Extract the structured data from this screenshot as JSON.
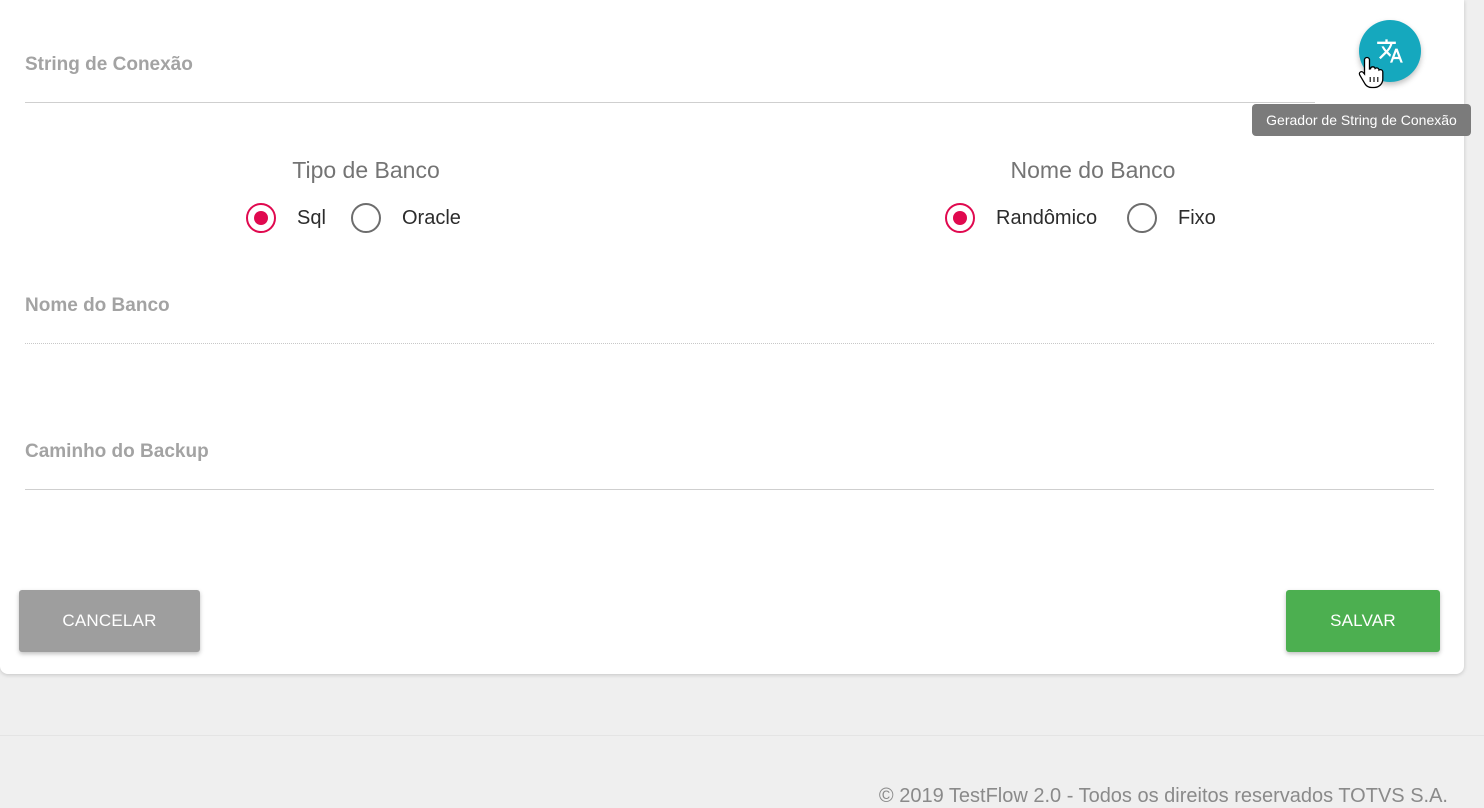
{
  "form": {
    "connection_string_label": "String de Conexão",
    "db_name_label": "Nome do Banco",
    "backup_path_label": "Caminho do Backup",
    "connection_string_value": "",
    "db_name_value": "",
    "backup_path_value": ""
  },
  "fab": {
    "icon": "translate-icon",
    "tooltip": "Gerador de String de Conexão",
    "color": "#15a8be"
  },
  "db_type": {
    "title": "Tipo de Banco",
    "options": [
      {
        "label": "Sql",
        "checked": true
      },
      {
        "label": "Oracle",
        "checked": false
      }
    ]
  },
  "db_name_mode": {
    "title": "Nome do Banco",
    "options": [
      {
        "label": "Randômico",
        "checked": true
      },
      {
        "label": "Fixo",
        "checked": false
      }
    ]
  },
  "actions": {
    "cancel_label": "CANCELAR",
    "save_label": "SALVAR"
  },
  "colors": {
    "accent_radio": "#e0094f",
    "save_button": "#4caf50",
    "cancel_button": "#9e9e9e"
  },
  "footer": {
    "text": "© 2019 TestFlow 2.0 - Todos os direitos reservados TOTVS S.A."
  }
}
